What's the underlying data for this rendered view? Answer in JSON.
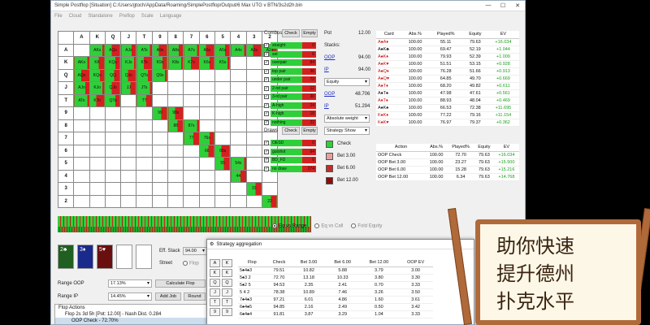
{
  "window": {
    "title": "Simple Postflop [Situation] C:/Users/gtoch/AppData/Roaming/SimplePostflop/Output/6 Max UTG v BTN/3s2d2h.bin",
    "controls": [
      "—",
      "☐",
      "✕"
    ]
  },
  "menu": [
    "File",
    "Cloud",
    "Standalone",
    "Preflop",
    "Scale",
    "Language"
  ],
  "matrix": {
    "headers": [
      "A",
      "K",
      "Q",
      "J",
      "T",
      "9",
      "8",
      "7",
      "6",
      "5",
      "4",
      "3",
      "2"
    ],
    "rows": [
      [
        "A",
        "",
        "AKs",
        "AQs",
        "AJs",
        "ATs",
        "A9s",
        "A8s",
        "A7s",
        "A6s",
        "A5s",
        "A4s",
        "A3s",
        "A2s"
      ],
      [
        "K",
        "AKo",
        "KK",
        "KQs",
        "KJs",
        "KTs",
        "K9s",
        "K8s",
        "K7s",
        "K6s",
        "K5s",
        "",
        "",
        ""
      ],
      [
        "Q",
        "AQo",
        "KQo",
        "QQ",
        "QJs",
        "QTs",
        "Q9s",
        "",
        "",
        "",
        "",
        "",
        "",
        ""
      ],
      [
        "J",
        "AJo",
        "KJo",
        "QJo",
        "JJ",
        "JTs",
        "",
        "",
        "",
        "",
        "",
        "",
        "",
        ""
      ],
      [
        "T",
        "ATo",
        "KTo",
        "QTo",
        "",
        "TT",
        "",
        "",
        "",
        "",
        "",
        "",
        "",
        ""
      ],
      [
        "9",
        "",
        "",
        "",
        "",
        "",
        "99",
        "98s",
        "",
        "",
        "",
        "",
        "",
        ""
      ],
      [
        "8",
        "",
        "",
        "",
        "",
        "",
        "",
        "88",
        "87s",
        "",
        "",
        "",
        "",
        ""
      ],
      [
        "7",
        "",
        "",
        "",
        "",
        "",
        "",
        "",
        "77",
        "76s",
        "",
        "",
        "",
        ""
      ],
      [
        "6",
        "",
        "",
        "",
        "",
        "",
        "",
        "",
        "",
        "66",
        "65s",
        "",
        "",
        ""
      ],
      [
        "5",
        "",
        "",
        "",
        "",
        "",
        "",
        "",
        "",
        "",
        "55",
        "54s",
        "",
        ""
      ],
      [
        "4",
        "",
        "",
        "",
        "",
        "",
        "",
        "",
        "",
        "",
        "",
        "44",
        "",
        ""
      ],
      [
        "3",
        "",
        "",
        "",
        "",
        "",
        "",
        "",
        "",
        "",
        "",
        "",
        "33",
        ""
      ],
      [
        "2",
        "",
        "",
        "",
        "",
        "",
        "",
        "",
        "",
        "",
        "",
        "",
        "",
        "22"
      ]
    ]
  },
  "combos": {
    "label": "Combos",
    "check_btn": "Check",
    "empty_btn": "Empty",
    "items": [
      {
        "name": "straight",
        "count": "0"
      },
      {
        "name": "set",
        "count": "6"
      },
      {
        "name": "overpair",
        "count": "84"
      },
      {
        "name": "top pair",
        "count": "36"
      },
      {
        "name": "under pair",
        "count": "72"
      },
      {
        "name": "2-nd pair",
        "count": "12"
      },
      {
        "name": "3-rd pair",
        "count": "30"
      },
      {
        "name": "A-high",
        "count": "24"
      },
      {
        "name": "K-high",
        "count": "18"
      },
      {
        "name": "nothing",
        "count": "22"
      }
    ]
  },
  "draws": {
    "label": "Draws",
    "check_btn": "Check",
    "empty_btn": "Empty",
    "items": [
      {
        "name": "OESD",
        "count": "0"
      },
      {
        "name": "gutshot",
        "count": "64"
      },
      {
        "name": "BD_FD",
        "count": "0"
      },
      {
        "name": "no draw",
        "count": "274"
      }
    ]
  },
  "pot": {
    "pot_label": "Pot",
    "pot_value": "12.00",
    "stacks_label": "Stacks:",
    "oop_label": "OOP",
    "oop_stack": "94.00",
    "ip_label": "IP",
    "ip_stack": "94.00",
    "mode": "Equity",
    "oop_eq": "48.706",
    "ip_eq": "51.294",
    "weight_mode": "Absolute weight",
    "strategy_mode": "Strategy Show"
  },
  "legend": [
    {
      "label": "Check",
      "color": "#2fcf3a"
    },
    {
      "label": "Bet 3.00",
      "color": "#e6a0a0"
    },
    {
      "label": "Bet 6.00",
      "color": "#c52a2a"
    },
    {
      "label": "Bet 12.00",
      "color": "#8a0e0e"
    }
  ],
  "card_table": {
    "headers": [
      "Card",
      "Abs.%",
      "Played%",
      "Equity",
      "EV"
    ],
    "rows": [
      [
        "A♠A♦",
        "100.00",
        "55.11",
        "79.63",
        "+16.034"
      ],
      [
        "A♠K♣",
        "100.00",
        "69.47",
        "52.19",
        "+1.044"
      ],
      [
        "A♠K♦",
        "100.00",
        "79.93",
        "52.39",
        "+1.009"
      ],
      [
        "A♠K♥",
        "100.00",
        "51.51",
        "53.15",
        "+0.928"
      ],
      [
        "A♠Q♦",
        "100.00",
        "76.28",
        "51.66",
        "+0.913"
      ],
      [
        "A♠Q♥",
        "100.00",
        "64.85",
        "49.70",
        "+0.669"
      ],
      [
        "A♠T♦",
        "100.00",
        "68.20",
        "49.82",
        "+0.611"
      ],
      [
        "A♠T♠",
        "100.00",
        "47.98",
        "47.61",
        "+0.561"
      ],
      [
        "A♦T♦",
        "100.00",
        "88.93",
        "48.04",
        "+0.469"
      ],
      [
        "A♠K♠",
        "100.00",
        "66.53",
        "72.38",
        "+11.695"
      ],
      [
        "K♠K♦",
        "100.00",
        "77.22",
        "79.16",
        "+11.154"
      ],
      [
        "K♠K♥",
        "100.00",
        "76.97",
        "79.37",
        "+0.362"
      ]
    ]
  },
  "action_table": {
    "headers": [
      "Action",
      "Abs.%",
      "Played%",
      "Equity",
      "EV"
    ],
    "rows": [
      [
        "OOP Check",
        "100.00",
        "72.70",
        "79.63",
        "+16.034"
      ],
      [
        "OOP Bet 3.00",
        "100.00",
        "23.27",
        "79.63",
        "+15.500"
      ],
      [
        "OOP Bet 6.00",
        "100.00",
        "15.28",
        "79.63",
        "+15.216"
      ],
      [
        "OOP Bet 12.00",
        "100.00",
        "6.34",
        "79.63",
        "+14.768"
      ]
    ]
  },
  "eq_options": [
    "Eq vs Range",
    "Eq vs Call",
    "Fold Equity"
  ],
  "board": {
    "cards": [
      {
        "text": "2♣",
        "color": "#1f5f1f"
      },
      {
        "text": "3♦",
        "color": "#1a2a8a"
      },
      {
        "text": "5♥",
        "color": "#6a0f0f"
      }
    ]
  },
  "controls": {
    "eff_stack_label": "Eff. Stack",
    "eff_stack_value": "94.00",
    "street_label": "Street",
    "street_value": "Flop",
    "range_oop_label": "Range OOP",
    "range_oop_value": "17.13%",
    "range_ip_label": "Range IP",
    "range_ip_value": "14.45%",
    "calc_btn": "Calculate Flop",
    "add_job_btn": "Add Job",
    "round_btn": "Round"
  },
  "flop_actions": {
    "title": "Flop Actions",
    "line1": "Flop 2s 3d 5h [Pot: 12.00] - Nash Dist. 0.284",
    "line2": "OOP Check - 72.70%"
  },
  "aggregation": {
    "title": "Strategy aggregation",
    "rank_buttons": [
      "A",
      "K",
      "K",
      "K",
      "Q",
      "Q",
      "J",
      "J",
      "T",
      "T",
      "9",
      "9"
    ],
    "headers": [
      "Flop",
      "Check",
      "Bet 3.00",
      "Bet 6.00",
      "Bet 12.00",
      "OOP EV"
    ],
    "rows": [
      [
        "5♠4♠3",
        "79.51",
        "10.82",
        "5.88",
        "3.79",
        "3.00"
      ],
      [
        "5♠3 2",
        "72.70",
        "13.18",
        "10.33",
        "3.80",
        "3.30"
      ],
      [
        "5♠2 5",
        "94.53",
        "2.35",
        "2.41",
        "0.70",
        "3.33"
      ],
      [
        "5 4 2",
        "78.38",
        "10.89",
        "7.46",
        "3.26",
        "3.50"
      ],
      [
        "7♠4♠3",
        "97.21",
        "6.01",
        "4.86",
        "1.60",
        "3.61"
      ],
      [
        "6♠4♠5",
        "94.85",
        "2.16",
        "2.49",
        "0.50",
        "3.42"
      ],
      [
        "6♠4♠4",
        "91.81",
        "3.87",
        "3.29",
        "1.04",
        "3.33"
      ]
    ]
  },
  "sign": {
    "line1": "助你快速",
    "line2": "提升德州",
    "line3": "扑克水平"
  }
}
